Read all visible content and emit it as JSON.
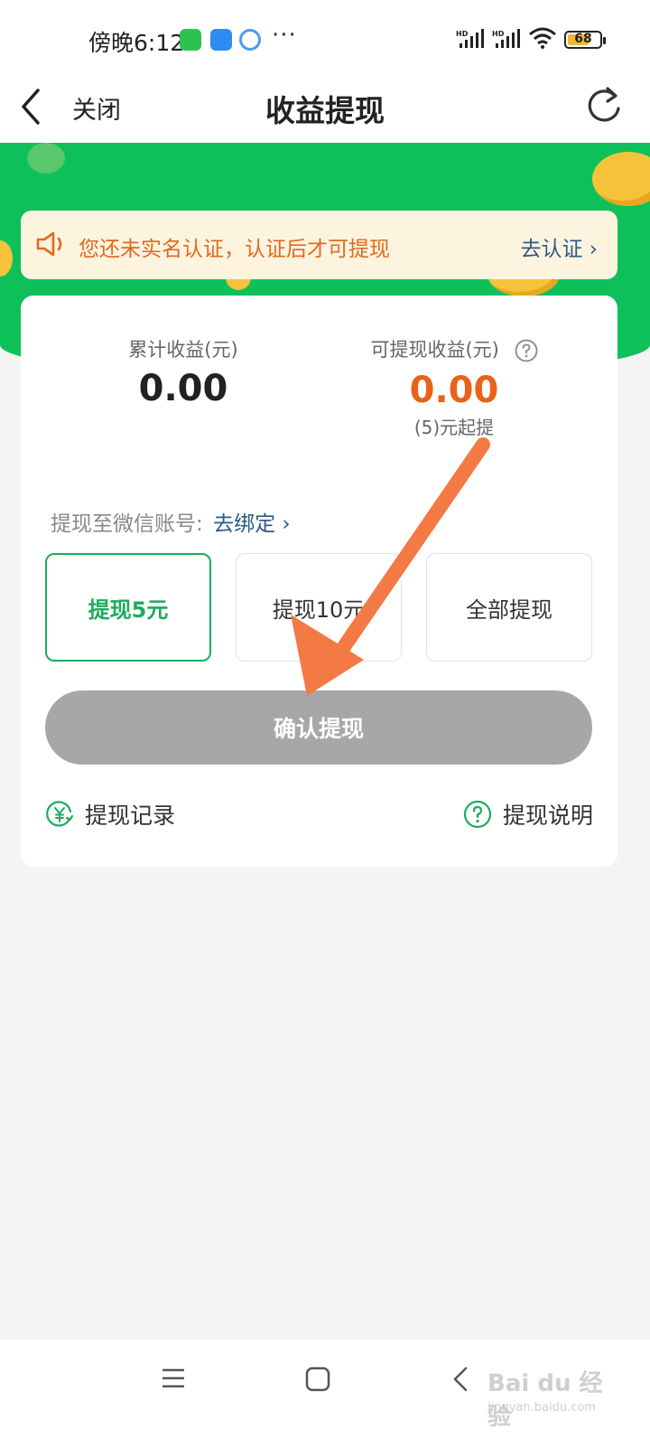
{
  "status_bar": {
    "time": "傍晚6:12",
    "more": "···",
    "battery": "68",
    "battery_level": 0.68,
    "icons": [
      "wechat-icon",
      "cloud-icon",
      "browser-icon",
      "hd-signal-icon",
      "hd-signal-icon",
      "wifi-icon",
      "battery-icon"
    ]
  },
  "nav": {
    "back_icon": "chevron-left-icon",
    "close_label": "关闭",
    "title": "收益提现",
    "refresh_icon": "refresh-icon"
  },
  "notice": {
    "icon": "speaker-icon",
    "text": "您还未实名认证，认证后才可提现",
    "link": "去认证 ›"
  },
  "stats": {
    "total_label": "累计收益(元)",
    "total_value": "0.00",
    "available_label": "可提现收益(元)",
    "available_value": "0.00",
    "available_note": "(5)元起提"
  },
  "bind": {
    "label": "提现至微信账号:",
    "link": "去绑定 ›"
  },
  "options": [
    {
      "label": "提现5元",
      "selected": true
    },
    {
      "label": "提现10元",
      "selected": false
    },
    {
      "label": "全部提现",
      "selected": false
    }
  ],
  "confirm_label": "确认提现",
  "footer": {
    "records_label": "提现记录",
    "help_label": "提现说明"
  },
  "watermark": {
    "text": "Bai du 经验",
    "sub": "jingyan.baidu.com"
  },
  "colors": {
    "brand_green": "#0ec05a",
    "accent_orange": "#e8631a",
    "link_blue": "#2c5a86",
    "arrow_orange": "#f47a45"
  }
}
